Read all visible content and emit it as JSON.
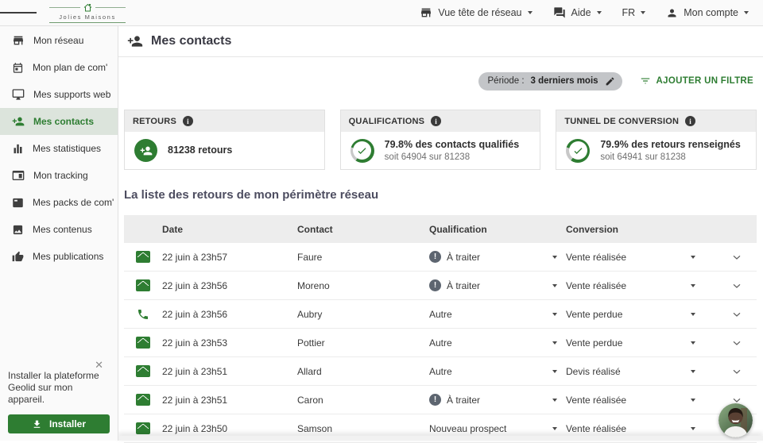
{
  "colors": {
    "primary_green": "#2e7d32",
    "active_item_bg": "#dce4dc",
    "warning_grey": "#5d6570",
    "ring_track": "#c8c8c8"
  },
  "topbar": {
    "logo_text": "Jolies Maisons",
    "logo_icon": "house-icon",
    "menu": [
      {
        "label": "Vue tête de réseau",
        "icon": "storefront-icon"
      },
      {
        "label": "Aide",
        "icon": "chat-icon"
      },
      {
        "label": "FR",
        "icon": ""
      },
      {
        "label": "Mon compte",
        "icon": "person-icon"
      }
    ]
  },
  "sidebar": {
    "items": [
      {
        "label": "Mon réseau",
        "icon": "storefront-icon"
      },
      {
        "label": "Mon plan de com'",
        "icon": "calendar-icon"
      },
      {
        "label": "Mes supports web",
        "icon": "monitor-icon"
      },
      {
        "label": "Mes contacts",
        "icon": "person-add-icon",
        "active": true
      },
      {
        "label": "Mes statistiques",
        "icon": "bar-chart-icon"
      },
      {
        "label": "Mon tracking",
        "icon": "browser-icon"
      },
      {
        "label": "Mes packs de com'",
        "icon": "package-icon"
      },
      {
        "label": "Mes contenus",
        "icon": "image-icon"
      },
      {
        "label": "Mes publications",
        "icon": "thumb-up-icon"
      }
    ],
    "install_prompt": {
      "text_line1": "Installer la plateforme",
      "text_line2": "Geolid sur mon appareil.",
      "button_label": "Installer",
      "button_icon": "download-icon",
      "close_icon": "✕"
    }
  },
  "page": {
    "title": "Mes contacts",
    "title_icon": "person-add-icon"
  },
  "filters": {
    "period_label": "Période :",
    "period_value": "3 derniers mois",
    "period_edit_icon": "pencil-icon",
    "add_filter_label": "AJOUTER UN FILTRE",
    "add_filter_icon": "filter-icon"
  },
  "cards": [
    {
      "header": "RETOURS",
      "info_icon": "info-icon",
      "value": "81238 retours",
      "main_icon": "person-add-icon"
    },
    {
      "header": "QUALIFICATIONS",
      "info_icon": "info-icon",
      "value": "79.8% des contacts qualifiés",
      "subvalue": "soit 64904 sur 81238",
      "percent": 79.8,
      "main_icon": "check-ring-icon"
    },
    {
      "header": "TUNNEL DE CONVERSION",
      "info_icon": "info-icon",
      "value": "79.9% des retours renseignés",
      "subvalue": "soit 64941 sur 81238",
      "percent": 79.9,
      "main_icon": "check-ring-icon"
    }
  ],
  "section_title": "La liste des retours de mon périmètre réseau",
  "table": {
    "headers": [
      "Date",
      "Contact",
      "Qualification",
      "Conversion"
    ],
    "rows": [
      {
        "channel": "email",
        "date": "22 juin à 23h57",
        "contact": "Faure",
        "qualification": "À traiter",
        "qualification_warning": true,
        "conversion": "Vente réalisée"
      },
      {
        "channel": "email",
        "date": "22 juin à 23h56",
        "contact": "Moreno",
        "qualification": "À traiter",
        "qualification_warning": true,
        "conversion": "Vente réalisée"
      },
      {
        "channel": "phone",
        "date": "22 juin à 23h56",
        "contact": "Aubry",
        "qualification": "Autre",
        "qualification_warning": false,
        "conversion": "Vente perdue"
      },
      {
        "channel": "email",
        "date": "22 juin à 23h53",
        "contact": "Pottier",
        "qualification": "Autre",
        "qualification_warning": false,
        "conversion": "Vente perdue"
      },
      {
        "channel": "email",
        "date": "22 juin à 23h51",
        "contact": "Allard",
        "qualification": "Autre",
        "qualification_warning": false,
        "conversion": "Devis réalisé"
      },
      {
        "channel": "email",
        "date": "22 juin à 23h51",
        "contact": "Caron",
        "qualification": "À traiter",
        "qualification_warning": true,
        "conversion": "Vente réalisée"
      },
      {
        "channel": "email",
        "date": "22 juin à 23h50",
        "contact": "Samson",
        "qualification": "Nouveau prospect",
        "qualification_warning": false,
        "conversion": "Vente réalisée"
      }
    ]
  }
}
